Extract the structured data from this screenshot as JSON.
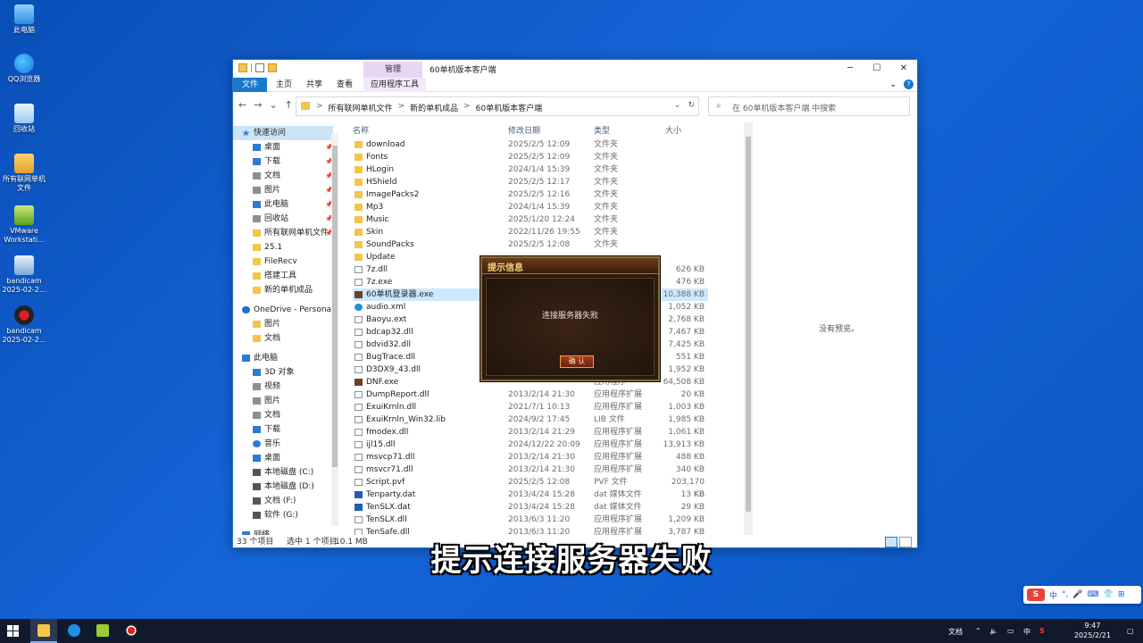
{
  "desktop": {
    "icons": [
      {
        "label": "此电脑"
      },
      {
        "label": "QQ浏览器"
      },
      {
        "label": "回收站"
      },
      {
        "label": "所有联网单机文件"
      },
      {
        "label": "VMware Workstati..."
      },
      {
        "label": "bandicam 2025-02-2..."
      },
      {
        "label": "bandicam 2025-02-2..."
      }
    ]
  },
  "window": {
    "title": "60单机版本客户端",
    "manage_tab": "管理",
    "controls": {
      "minimize": "─",
      "maximize": "☐",
      "close": "✕"
    },
    "ribbon_tabs": [
      "文件",
      "主页",
      "共享",
      "查看",
      "应用程序工具"
    ],
    "nav": {
      "back": "←",
      "forward": "→",
      "recent": "⌄",
      "up": "↑"
    },
    "address": {
      "crumbs": [
        "所有联网单机文件",
        "新的单机成品",
        "60单机版本客户端"
      ],
      "separator": ">",
      "dropdown": "⌄",
      "refresh": "↻"
    },
    "search": {
      "placeholder": "在 60单机版本客户端 中搜索",
      "icon": "search-icon"
    },
    "navpane": [
      {
        "label": "快速访问",
        "icon": "star",
        "pinned": false
      },
      {
        "label": "桌面",
        "icon": "blue",
        "pinned": true
      },
      {
        "label": "下载",
        "icon": "blue",
        "pinned": true
      },
      {
        "label": "文档",
        "icon": "gray",
        "pinned": true
      },
      {
        "label": "图片",
        "icon": "gray",
        "pinned": true
      },
      {
        "label": "此电脑",
        "icon": "blue",
        "pinned": true
      },
      {
        "label": "回收站",
        "icon": "gray",
        "pinned": true
      },
      {
        "label": "所有联网单机文件",
        "icon": "yellow",
        "pinned": true
      },
      {
        "label": "25.1",
        "icon": "yellow",
        "pinned": false
      },
      {
        "label": "FileRecv",
        "icon": "yellow",
        "pinned": false
      },
      {
        "label": "搭建工具",
        "icon": "yellow",
        "pinned": false
      },
      {
        "label": "新的单机成品",
        "icon": "yellow",
        "pinned": false
      },
      {
        "label": "OneDrive - Personal",
        "icon": "cloud",
        "pinned": false
      },
      {
        "label": "图片",
        "icon": "yellow",
        "pinned": false
      },
      {
        "label": "文档",
        "icon": "yellow",
        "pinned": false
      },
      {
        "label": "此电脑",
        "icon": "blue",
        "pinned": false
      },
      {
        "label": "3D 对象",
        "icon": "blue",
        "pinned": false
      },
      {
        "label": "视频",
        "icon": "gray",
        "pinned": false
      },
      {
        "label": "图片",
        "icon": "gray",
        "pinned": false
      },
      {
        "label": "文档",
        "icon": "gray",
        "pinned": false
      },
      {
        "label": "下载",
        "icon": "blue",
        "pinned": false
      },
      {
        "label": "音乐",
        "icon": "music",
        "pinned": false
      },
      {
        "label": "桌面",
        "icon": "blue",
        "pinned": false
      },
      {
        "label": "本地磁盘 (C:)",
        "icon": "dark",
        "pinned": false
      },
      {
        "label": "本地磁盘 (D:)",
        "icon": "dark",
        "pinned": false
      },
      {
        "label": "文档 (F:)",
        "icon": "dark",
        "pinned": false
      },
      {
        "label": "软件 (G:)",
        "icon": "dark",
        "pinned": false
      },
      {
        "label": "网络",
        "icon": "blue",
        "pinned": false
      }
    ],
    "columns": {
      "name": "名称",
      "date": "修改日期",
      "type": "类型",
      "size": "大小"
    },
    "files": [
      {
        "name": "download",
        "date": "2025/2/5 12:09",
        "type": "文件夹",
        "size": "",
        "icon": "yellow"
      },
      {
        "name": "Fonts",
        "date": "2025/2/5 12:09",
        "type": "文件夹",
        "size": "",
        "icon": "yellow"
      },
      {
        "name": "HLogin",
        "date": "2024/1/4 15:39",
        "type": "文件夹",
        "size": "",
        "icon": "yellow"
      },
      {
        "name": "HShield",
        "date": "2025/2/5 12:17",
        "type": "文件夹",
        "size": "",
        "icon": "yellow"
      },
      {
        "name": "ImagePacks2",
        "date": "2025/2/5 12:16",
        "type": "文件夹",
        "size": "",
        "icon": "yellow"
      },
      {
        "name": "Mp3",
        "date": "2024/1/4 15:39",
        "type": "文件夹",
        "size": "",
        "icon": "yellow"
      },
      {
        "name": "Music",
        "date": "2025/1/20 12:24",
        "type": "文件夹",
        "size": "",
        "icon": "yellow"
      },
      {
        "name": "Skin",
        "date": "2022/11/26 19:55",
        "type": "文件夹",
        "size": "",
        "icon": "yellow"
      },
      {
        "name": "SoundPacks",
        "date": "2025/2/5 12:08",
        "type": "文件夹",
        "size": "",
        "icon": "yellow"
      },
      {
        "name": "Update",
        "date": "",
        "type": "",
        "size": "",
        "icon": "yellow"
      },
      {
        "name": "7z.dll",
        "date": "",
        "type": "",
        "size": "626 KB",
        "icon": "doc"
      },
      {
        "name": "7z.exe",
        "date": "",
        "type": "",
        "size": "476 KB",
        "icon": "doc"
      },
      {
        "name": "60单机登录器.exe",
        "date": "",
        "type": "",
        "size": "10,388 KB",
        "icon": "exe"
      },
      {
        "name": "audio.xml",
        "date": "",
        "type": "",
        "size": "1,052 KB",
        "icon": "edge"
      },
      {
        "name": "Baoyu.ext",
        "date": "",
        "type": "",
        "size": "2,768 KB",
        "icon": "doc"
      },
      {
        "name": "bdcap32.dll",
        "date": "",
        "type": "",
        "size": "7,467 KB",
        "icon": "doc"
      },
      {
        "name": "bdvid32.dll",
        "date": "",
        "type": "",
        "size": "7,425 KB",
        "icon": "doc"
      },
      {
        "name": "BugTrace.dll",
        "date": "",
        "type": "",
        "size": "551 KB",
        "icon": "doc"
      },
      {
        "name": "D3DX9_43.dll",
        "date": "",
        "type": "",
        "size": "1,952 KB",
        "icon": "doc"
      },
      {
        "name": "DNF.exe",
        "date": "",
        "type": "应用程序",
        "size": "64,508 KB",
        "icon": "exe"
      },
      {
        "name": "DumpReport.dll",
        "date": "2013/2/14 21:30",
        "type": "应用程序扩展",
        "size": "20 KB",
        "icon": "doc"
      },
      {
        "name": "ExuiKrnln.dll",
        "date": "2021/7/1 10:13",
        "type": "应用程序扩展",
        "size": "1,003 KB",
        "icon": "doc"
      },
      {
        "name": "ExuiKrnln_Win32.lib",
        "date": "2024/9/2 17:45",
        "type": "LIB 文件",
        "size": "1,985 KB",
        "icon": "doc"
      },
      {
        "name": "fmodex.dll",
        "date": "2013/2/14 21:29",
        "type": "应用程序扩展",
        "size": "1,061 KB",
        "icon": "doc"
      },
      {
        "name": "ijl15.dll",
        "date": "2024/12/22 20:09",
        "type": "应用程序扩展",
        "size": "13,913 KB",
        "icon": "doc"
      },
      {
        "name": "msvcp71.dll",
        "date": "2013/2/14 21:30",
        "type": "应用程序扩展",
        "size": "488 KB",
        "icon": "doc"
      },
      {
        "name": "msvcr71.dll",
        "date": "2013/2/14 21:30",
        "type": "应用程序扩展",
        "size": "340 KB",
        "icon": "doc"
      },
      {
        "name": "Script.pvf",
        "date": "2025/2/5 12:08",
        "type": "PVF 文件",
        "size": "203,170 KB",
        "icon": "doc"
      },
      {
        "name": "Tenparty.dat",
        "date": "2013/4/24 15:28",
        "type": "dat 媒体文件",
        "size": "13 KB",
        "icon": "dat"
      },
      {
        "name": "TenSLX.dat",
        "date": "2013/4/24 15:28",
        "type": "dat 媒体文件",
        "size": "29 KB",
        "icon": "dat"
      },
      {
        "name": "TenSLX.dll",
        "date": "2013/6/3 11:20",
        "type": "应用程序扩展",
        "size": "1,209 KB",
        "icon": "doc"
      },
      {
        "name": "TenSafe.dll",
        "date": "2013/6/3 11:20",
        "type": "应用程序扩展",
        "size": "3,787 KB",
        "icon": "doc"
      }
    ],
    "selected_index": 12,
    "preview_text": "没有预览。",
    "status": {
      "count": "33 个项目",
      "selection": "选中 1 个项目",
      "size": "10.1 MB"
    }
  },
  "dialog": {
    "title": "提示信息",
    "message": "连接服务器失败",
    "button": "确 认"
  },
  "subtitle": "提示连接服务器失败",
  "ime": {
    "logo": "S",
    "mode": "中",
    "punct": "°,",
    "mic": "🎤",
    "keyboard": "⌨",
    "skin": "👕",
    "grid": "⊞"
  },
  "taskbar": {
    "tray_label": "文档",
    "lang": "中",
    "time": "9:47",
    "date": "2025/2/21"
  }
}
